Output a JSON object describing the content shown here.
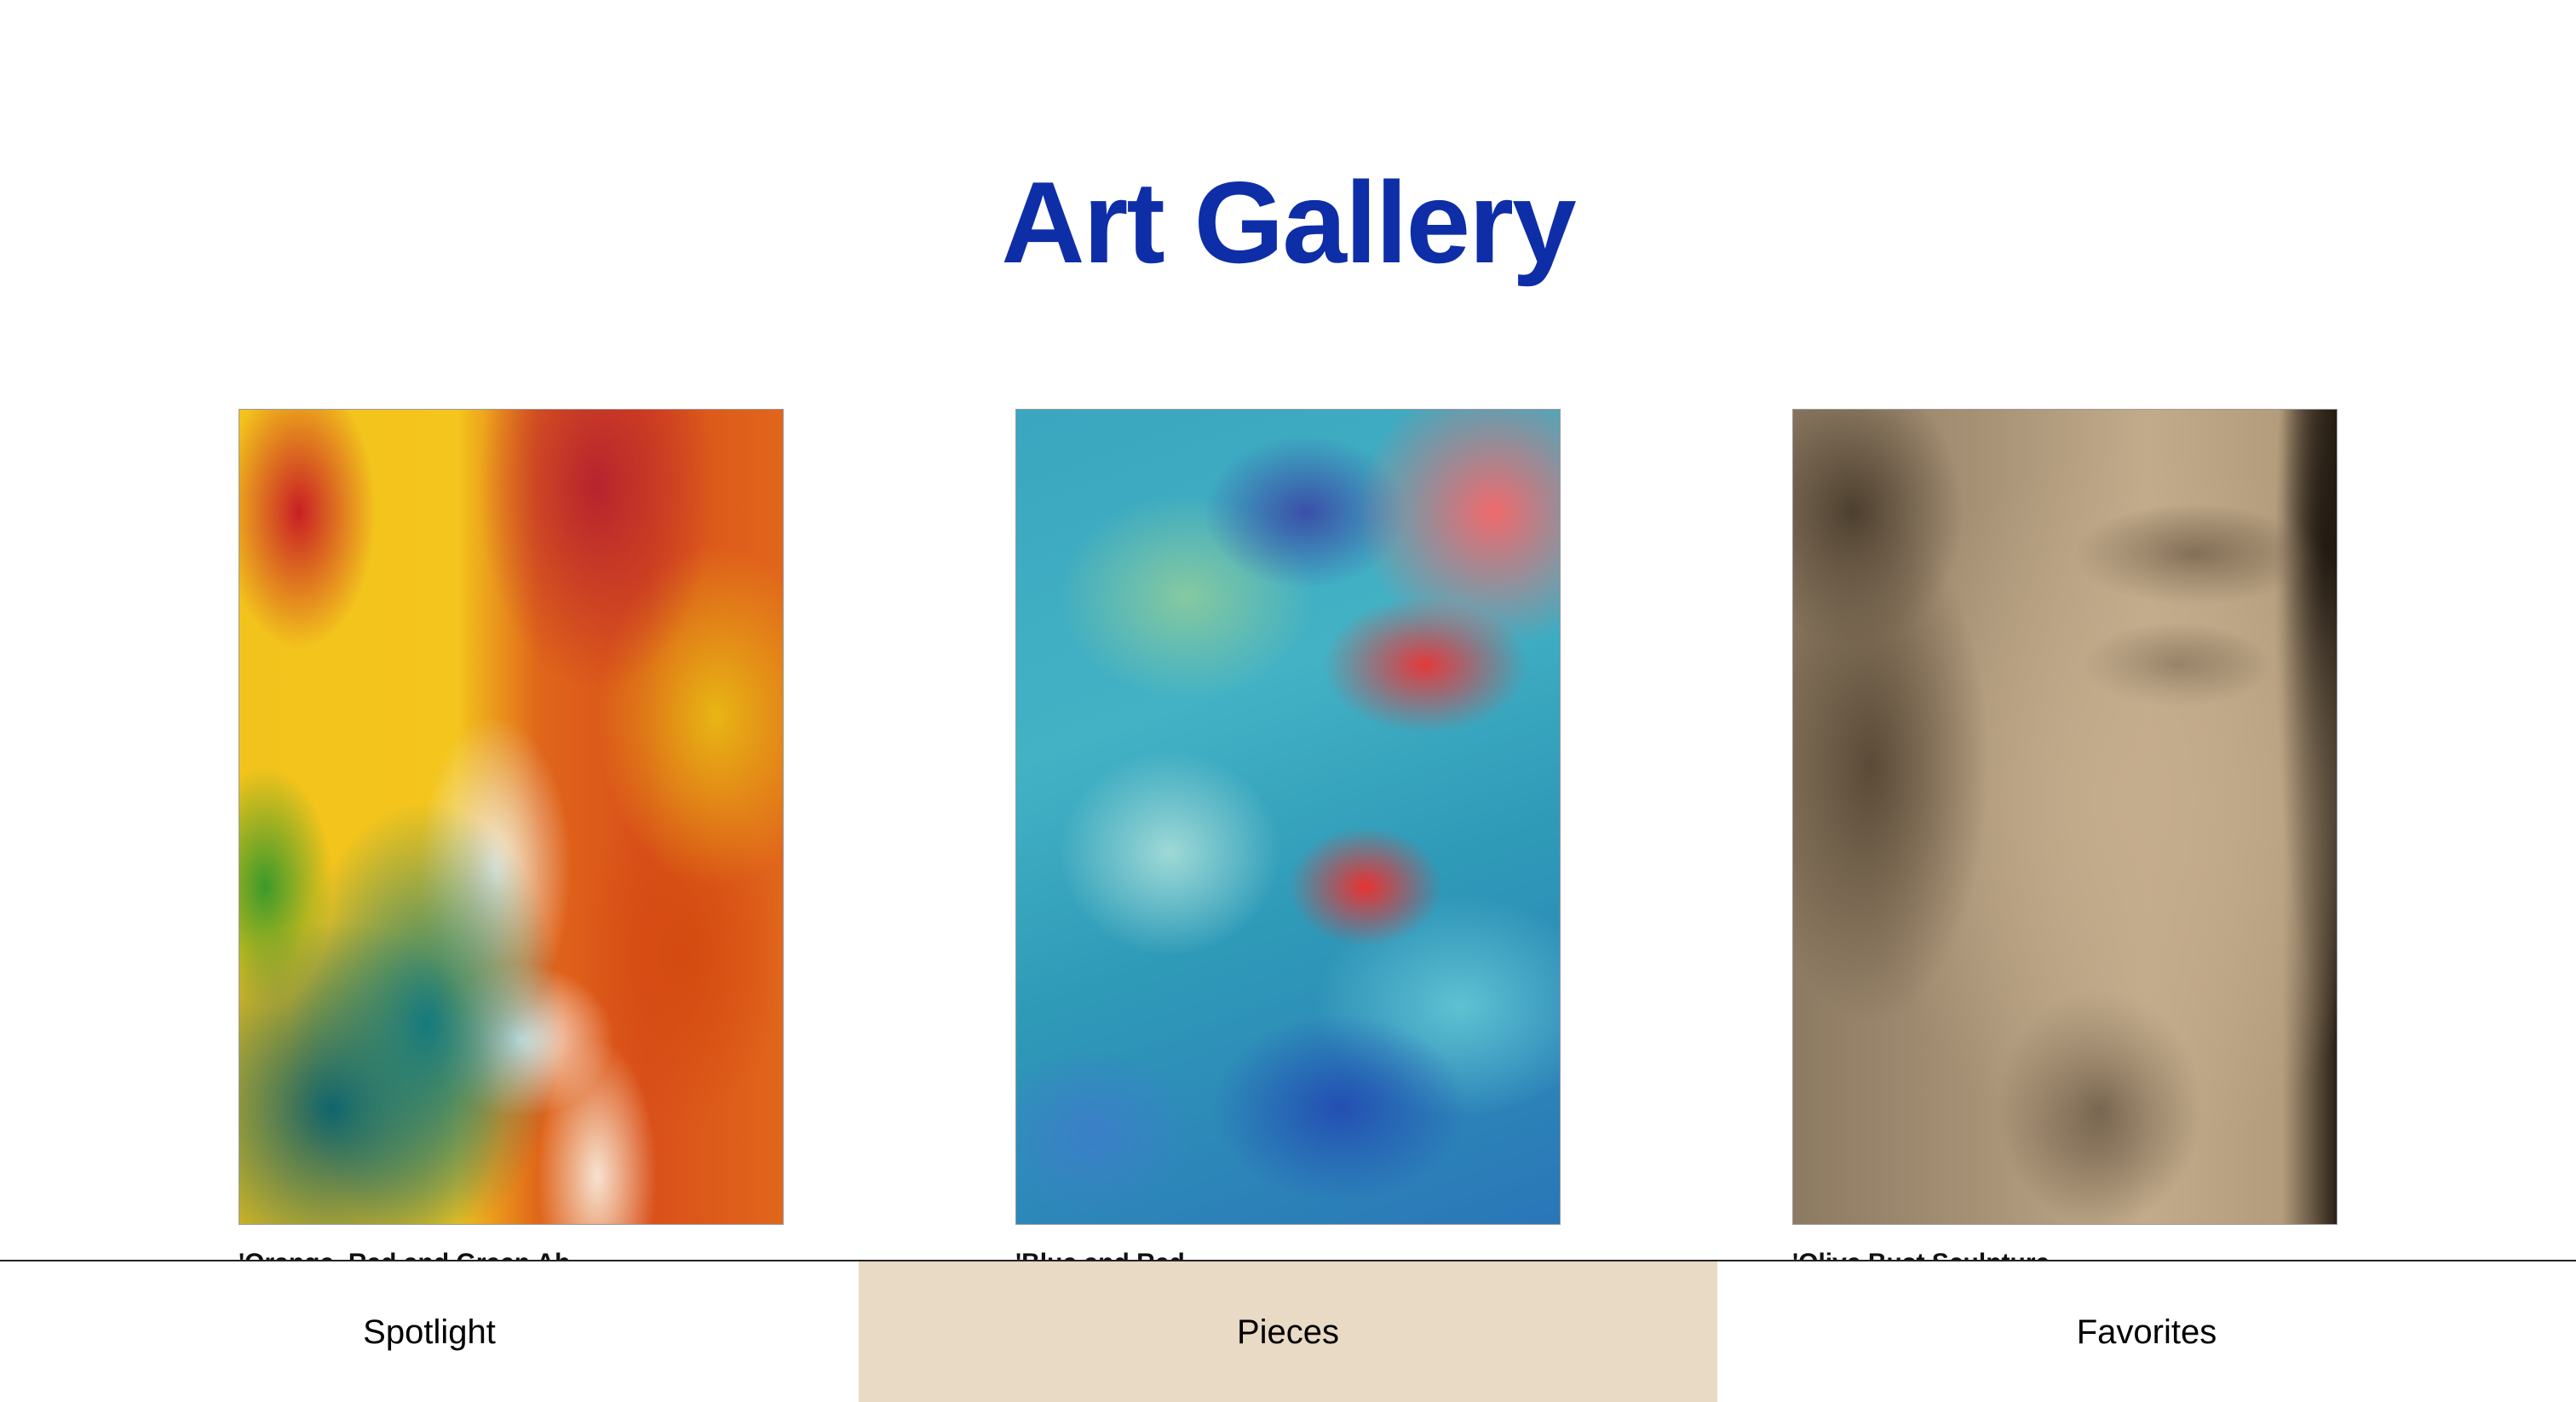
{
  "header": {
    "title": "Art Gallery",
    "title_color": "#0e2ea8"
  },
  "gallery": {
    "items": [
      {
        "image": "abstract-warm-painting",
        "caption": "'Orange, Red and Green Ab..."
      },
      {
        "image": "abstract-blue-painting",
        "caption": "'Blue and Red..."
      },
      {
        "image": "sepia-sculpture-face",
        "caption": "'Olive Bust Sculpture..."
      }
    ]
  },
  "nav": {
    "items": [
      {
        "label": "Spotlight",
        "active": false
      },
      {
        "label": "Pieces",
        "active": true
      },
      {
        "label": "Favorites",
        "active": false
      }
    ],
    "active_color": "#e8dac5"
  }
}
